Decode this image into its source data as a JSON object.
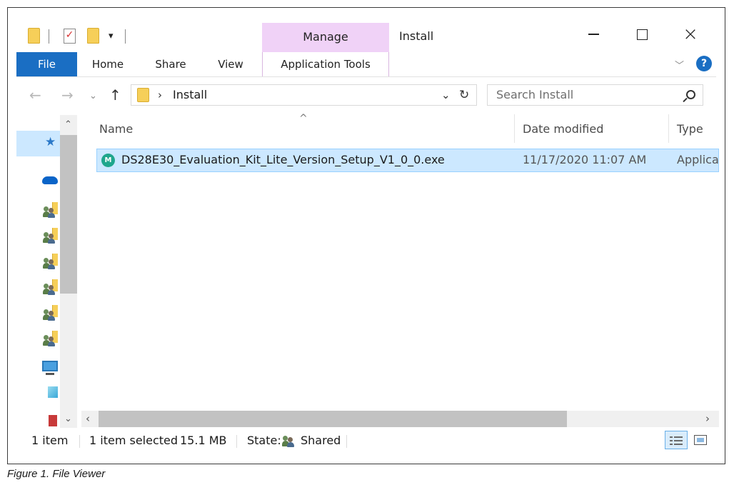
{
  "window": {
    "title": "Install",
    "contextual_tab_group": "Manage",
    "controls": {
      "minimize": "minimize",
      "maximize": "maximize",
      "close": "close"
    }
  },
  "quick_access": {
    "icons": [
      "folder-icon",
      "properties-check-icon",
      "new-folder-icon",
      "customize-dropdown-icon"
    ],
    "dropdown_glyph": "▾"
  },
  "ribbon": {
    "tabs": [
      {
        "label": "File",
        "active": true
      },
      {
        "label": "Home"
      },
      {
        "label": "Share"
      },
      {
        "label": "View"
      },
      {
        "label": "Application Tools"
      }
    ],
    "help_glyph": "?",
    "expand_glyph": "﹀"
  },
  "address_bar": {
    "path_separator": "›",
    "path": "Install",
    "search_placeholder": "Search Install"
  },
  "nav_pane": {
    "items": [
      "quick-access-pin-icon",
      "onedrive-icon",
      "shared-folder-icon",
      "shared-folder-icon",
      "shared-folder-icon",
      "shared-folder-icon",
      "shared-folder-icon",
      "shared-folder-icon",
      "this-pc-icon",
      "3d-objects-icon",
      "network-drive-icon"
    ]
  },
  "file_list": {
    "columns": {
      "name": "Name",
      "date_modified": "Date modified",
      "type": "Type"
    },
    "rows": [
      {
        "name": "DS28E30_Evaluation_Kit_Lite_Version_Setup_V1_0_0.exe",
        "date_modified": "11/17/2020 11:07 AM",
        "type": "Applica",
        "selected": true,
        "icon_glyph": "M"
      }
    ]
  },
  "status_bar": {
    "item_count": "1 item",
    "selection": "1 item selected",
    "size": "15.1 MB",
    "state_label": "State:",
    "state_value": "Shared"
  },
  "caption": "Figure 1. File Viewer",
  "colors": {
    "accent": "#1a6ec3",
    "manage_tab": "#f0d2f7",
    "selection": "#cce8ff",
    "folder": "#f6cf59"
  }
}
